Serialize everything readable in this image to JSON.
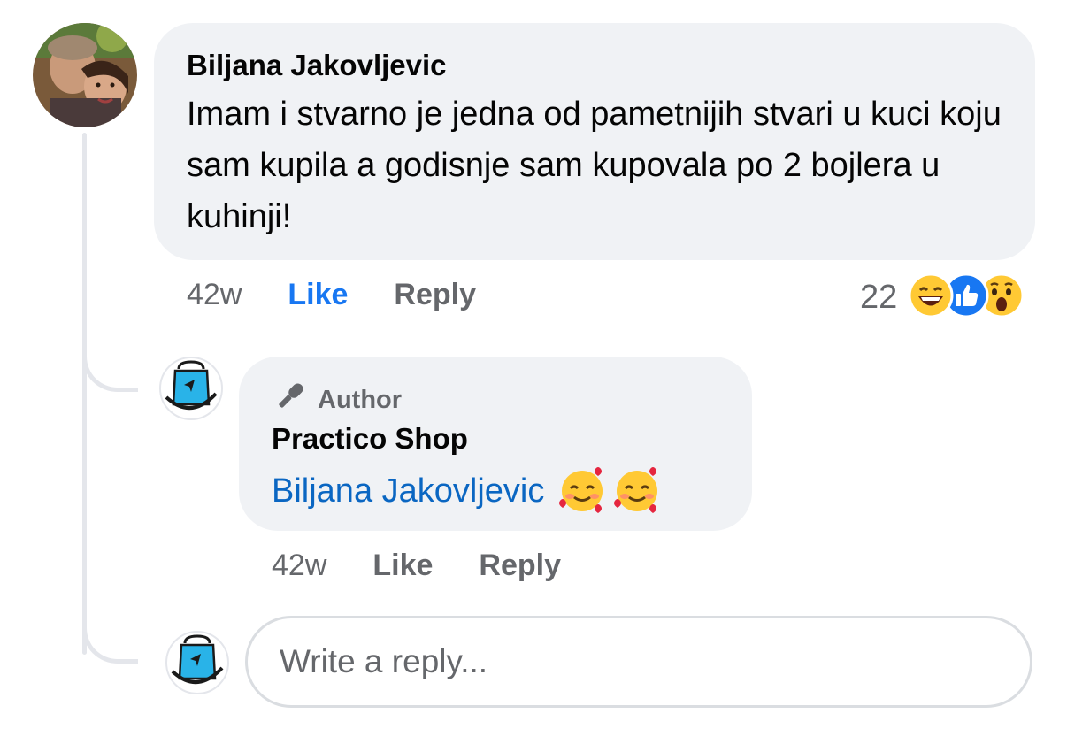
{
  "comment": {
    "author": "Biljana Jakovljevic",
    "text": "Imam i stvarno je jedna od pametnijih stvari u kuci koju sam kupila a godisnje sam kupovala po 2 bojlera u kuhinji!",
    "time": "42w",
    "like_label": "Like",
    "reply_label": "Reply",
    "reaction_count": "22",
    "reactions": [
      "laughing-face-icon",
      "thumbs-up-icon",
      "surprised-face-icon"
    ]
  },
  "reply": {
    "badge": "Author",
    "author": "Practico Shop",
    "mention": "Biljana Jakovljevic",
    "emojis": [
      "smiling-face-with-hearts-icon",
      "smiling-face-with-hearts-icon"
    ],
    "time": "42w",
    "like_label": "Like",
    "reply_label": "Reply"
  },
  "composer": {
    "placeholder": "Write a reply..."
  },
  "colors": {
    "bubble": "#f0f2f5",
    "link": "#0a66c2",
    "like_active": "#1877f2",
    "meta": "#65676b"
  }
}
